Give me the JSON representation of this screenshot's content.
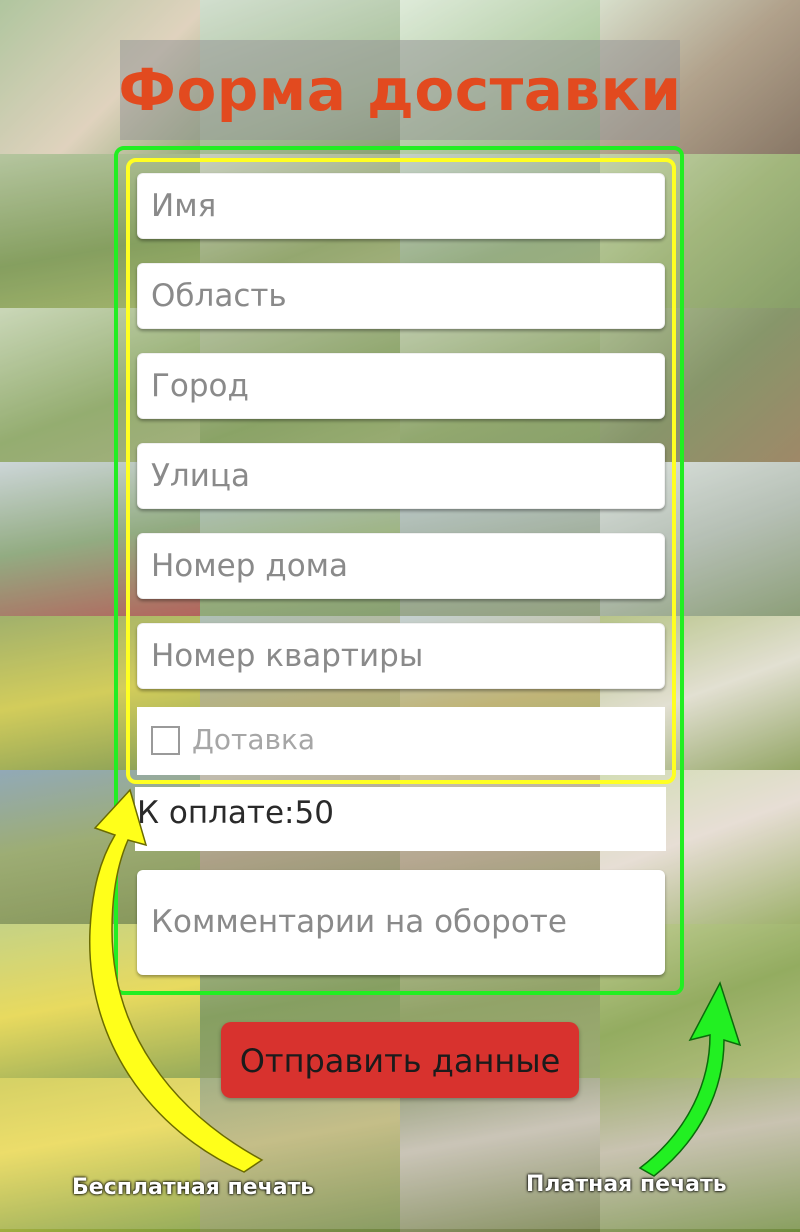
{
  "title": "Форма доставки",
  "form": {
    "name_placeholder": "Имя",
    "region_placeholder": "Область",
    "city_placeholder": "Город",
    "street_placeholder": "Улица",
    "house_placeholder": "Номер дома",
    "apartment_placeholder": "Номер квартиры",
    "delivery_checkbox_label": "Дотавка",
    "delivery_checked": false,
    "payment_text": "К оплате:50",
    "comment_placeholder": "Комментарии на обороте"
  },
  "submit_label": "Отправить данные",
  "annotations": {
    "free_label": "Бесплатная печать",
    "paid_label": "Платная печать"
  },
  "colors": {
    "title": "#e24a1f",
    "paid_frame": "#22ee22",
    "free_frame": "#ffff22",
    "submit_bg": "#d8322e"
  }
}
